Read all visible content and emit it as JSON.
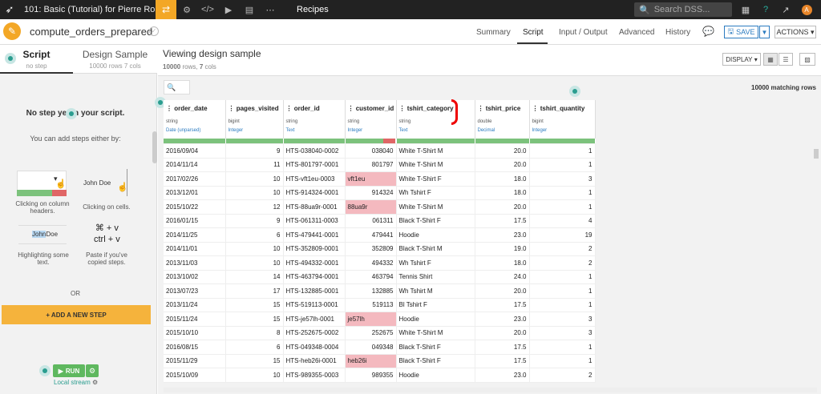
{
  "topbar": {
    "project_title": "101: Basic (Tutorial) for Pierre Ro...",
    "recipes_label": "Recipes",
    "search_placeholder": "Search DSS...",
    "avatar_letter": "A"
  },
  "recipe": {
    "name": "compute_orders_prepared",
    "tabs": [
      "Summary",
      "Script",
      "Input / Output",
      "Advanced",
      "History"
    ],
    "active_tab": "Script",
    "save_label": "SAVE",
    "actions_label": "ACTIONS"
  },
  "left": {
    "tab_script": "Script",
    "tab_script_sub": "no step",
    "tab_sample": "Design Sample",
    "tab_sample_sub": "10000 rows 7 cols",
    "no_step": "No step yet in your script.",
    "can_add": "You can add steps either by:",
    "hint_click_headers": "Clicking on column headers.",
    "hint_click_cells": "Clicking on cells.",
    "sample_name": "John Doe",
    "hint_highlight": "Highlighting some text.",
    "hint_paste": "Paste if you've copied steps.",
    "key_copy": "⌘ + v",
    "key_ctrl": "ctrl + v",
    "or": "OR",
    "add_step": "+ ADD A NEW STEP",
    "run": "RUN",
    "local_stream": "Local stream"
  },
  "main": {
    "title": "Viewing design sample",
    "sub_rows": "10000",
    "sub_rows_label": "rows,",
    "sub_cols": "7",
    "sub_cols_label": "cols",
    "display_label": "DISPLAY",
    "matching": "10000 matching rows"
  },
  "columns": [
    {
      "name": "order_date",
      "storage": "string",
      "meaning": "Date (unparsed)",
      "w": 77
    },
    {
      "name": "pages_visited",
      "storage": "bigint",
      "meaning": "Integer",
      "w": 72
    },
    {
      "name": "order_id",
      "storage": "string",
      "meaning": "Text",
      "w": 77
    },
    {
      "name": "customer_id",
      "storage": "string",
      "meaning": "Integer",
      "w": 64
    },
    {
      "name": "tshirt_category",
      "storage": "string",
      "meaning": "Text",
      "w": 98
    },
    {
      "name": "tshirt_price",
      "storage": "double",
      "meaning": "Decimal",
      "w": 68
    },
    {
      "name": "tshirt_quantity",
      "storage": "bigint",
      "meaning": "Integer",
      "w": 82
    }
  ],
  "rows": [
    [
      "2016/09/04",
      "9",
      "HTS-038040-0002",
      "038040",
      "White T-Shirt M",
      "20.0",
      "1"
    ],
    [
      "2014/11/14",
      "11",
      "HTS-801797-0001",
      "801797",
      "White T-Shirt M",
      "20.0",
      "1"
    ],
    [
      "2017/02/26",
      "10",
      "HTS-vft1eu-0003",
      "vft1eu",
      "White T-Shirt F",
      "18.0",
      "3"
    ],
    [
      "2013/12/01",
      "10",
      "HTS-914324-0001",
      "914324",
      "Wh Tshirt F",
      "18.0",
      "1"
    ],
    [
      "2015/10/22",
      "12",
      "HTS-88ua9r-0001",
      "88ua9r",
      "White T-Shirt M",
      "20.0",
      "1"
    ],
    [
      "2016/01/15",
      "9",
      "HTS-061311-0003",
      "061311",
      "Black T-Shirt F",
      "17.5",
      "4"
    ],
    [
      "2014/11/25",
      "6",
      "HTS-479441-0001",
      "479441",
      "Hoodie",
      "23.0",
      "19"
    ],
    [
      "2014/11/01",
      "10",
      "HTS-352809-0001",
      "352809",
      "Black T-Shirt M",
      "19.0",
      "2"
    ],
    [
      "2013/11/03",
      "10",
      "HTS-494332-0001",
      "494332",
      "Wh Tshirt F",
      "18.0",
      "2"
    ],
    [
      "2013/10/02",
      "14",
      "HTS-463794-0001",
      "463794",
      "Tennis Shirt",
      "24.0",
      "1"
    ],
    [
      "2013/07/23",
      "17",
      "HTS-132885-0001",
      "132885",
      "Wh Tshirt M",
      "20.0",
      "1"
    ],
    [
      "2013/11/24",
      "15",
      "HTS-519113-0001",
      "519113",
      "Bl Tshirt F",
      "17.5",
      "1"
    ],
    [
      "2015/11/24",
      "15",
      "HTS-je57lh-0001",
      "je57lh",
      "Hoodie",
      "23.0",
      "3"
    ],
    [
      "2015/10/10",
      "8",
      "HTS-252675-0002",
      "252675",
      "White T-Shirt M",
      "20.0",
      "3"
    ],
    [
      "2016/08/15",
      "6",
      "HTS-049348-0004",
      "049348",
      "Black T-Shirt F",
      "17.5",
      "1"
    ],
    [
      "2015/11/29",
      "15",
      "HTS-heb26i-0001",
      "heb26i",
      "Black T-Shirt F",
      "17.5",
      "1"
    ],
    [
      "2015/10/09",
      "10",
      "HTS-989355-0003",
      "989355",
      "Hoodie",
      "23.0",
      "2"
    ]
  ],
  "invalid_customer_ids": [
    "vft1eu",
    "88ua9r",
    "je57lh",
    "heb26i"
  ],
  "colors": {
    "accent": "#f3a726",
    "valid": "#7cc27c",
    "invalid": "#e06666",
    "invalid_cell": "#f4b9bf",
    "link": "#2b7bc0"
  }
}
